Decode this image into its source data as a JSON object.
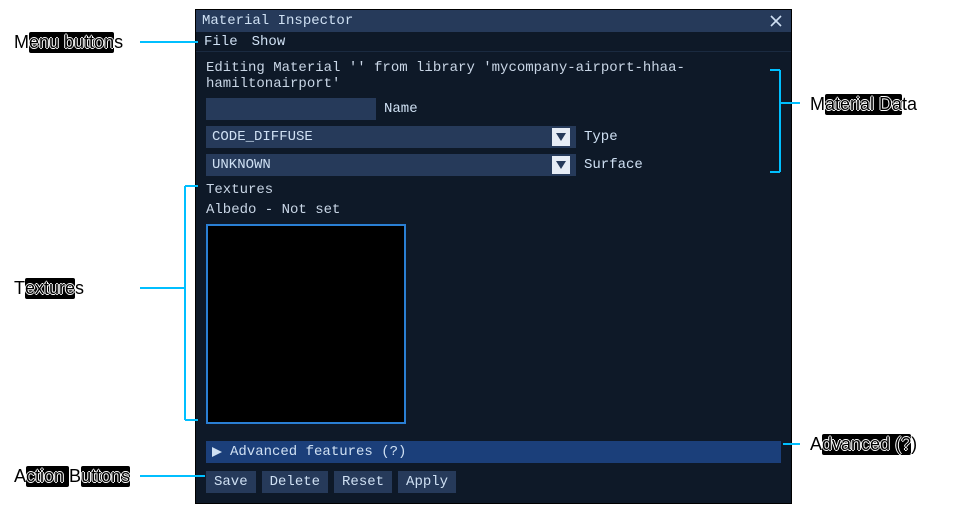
{
  "window": {
    "title": "Material Inspector"
  },
  "menu": {
    "file": "File",
    "show": "Show"
  },
  "main": {
    "editLine": "Editing Material '' from library 'mycompany-airport-hhaa-hamiltonairport'",
    "nameValue": "",
    "nameLabel": "Name",
    "typeValue": "CODE_DIFFUSE",
    "typeLabel": "Type",
    "surfaceValue": "UNKNOWN",
    "surfaceLabel": "Surface",
    "texturesHeader": "Textures",
    "albedoLabel": "Albedo - Not set"
  },
  "advanced": {
    "label": "Advanced features (?)"
  },
  "buttons": {
    "save": "Save",
    "delete": "Delete",
    "reset": "Reset",
    "apply": "Apply"
  },
  "callouts": {
    "leftTopA": "M",
    "leftTopB": "s",
    "leftMidA": "T",
    "leftMidB": "s",
    "leftBotA": "A",
    "leftBotB": "B",
    "rightTopA": "M",
    "rightTopB": "ta",
    "rightBotA": "A",
    "rightBotB": ")"
  }
}
